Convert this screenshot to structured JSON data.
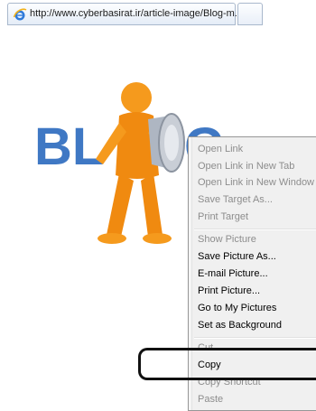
{
  "browser": {
    "tab_title": "http://www.cyberbasirat.ir/article-image/Blog-m...",
    "favicon": "ie-icon",
    "new_tab_icon": "new-tab-icon"
  },
  "image": {
    "text": "BLOG",
    "colors": {
      "letters": "#3f78c4",
      "figure": "#f59a1d",
      "megaphone": "#c9ced6"
    }
  },
  "context_menu": {
    "open_link": "Open Link",
    "open_link_new_tab": "Open Link in New Tab",
    "open_link_new_window": "Open Link in New Window",
    "save_target_as": "Save Target As...",
    "print_target": "Print Target",
    "show_picture": "Show Picture",
    "save_picture_as": "Save Picture As...",
    "email_picture": "E-mail Picture...",
    "print_picture": "Print Picture...",
    "go_to_my_pictures": "Go to My Pictures",
    "set_as_background": "Set as Background",
    "cut": "Cut",
    "copy": "Copy",
    "copy_shortcut": "Copy Shortcut",
    "paste": "Paste"
  }
}
